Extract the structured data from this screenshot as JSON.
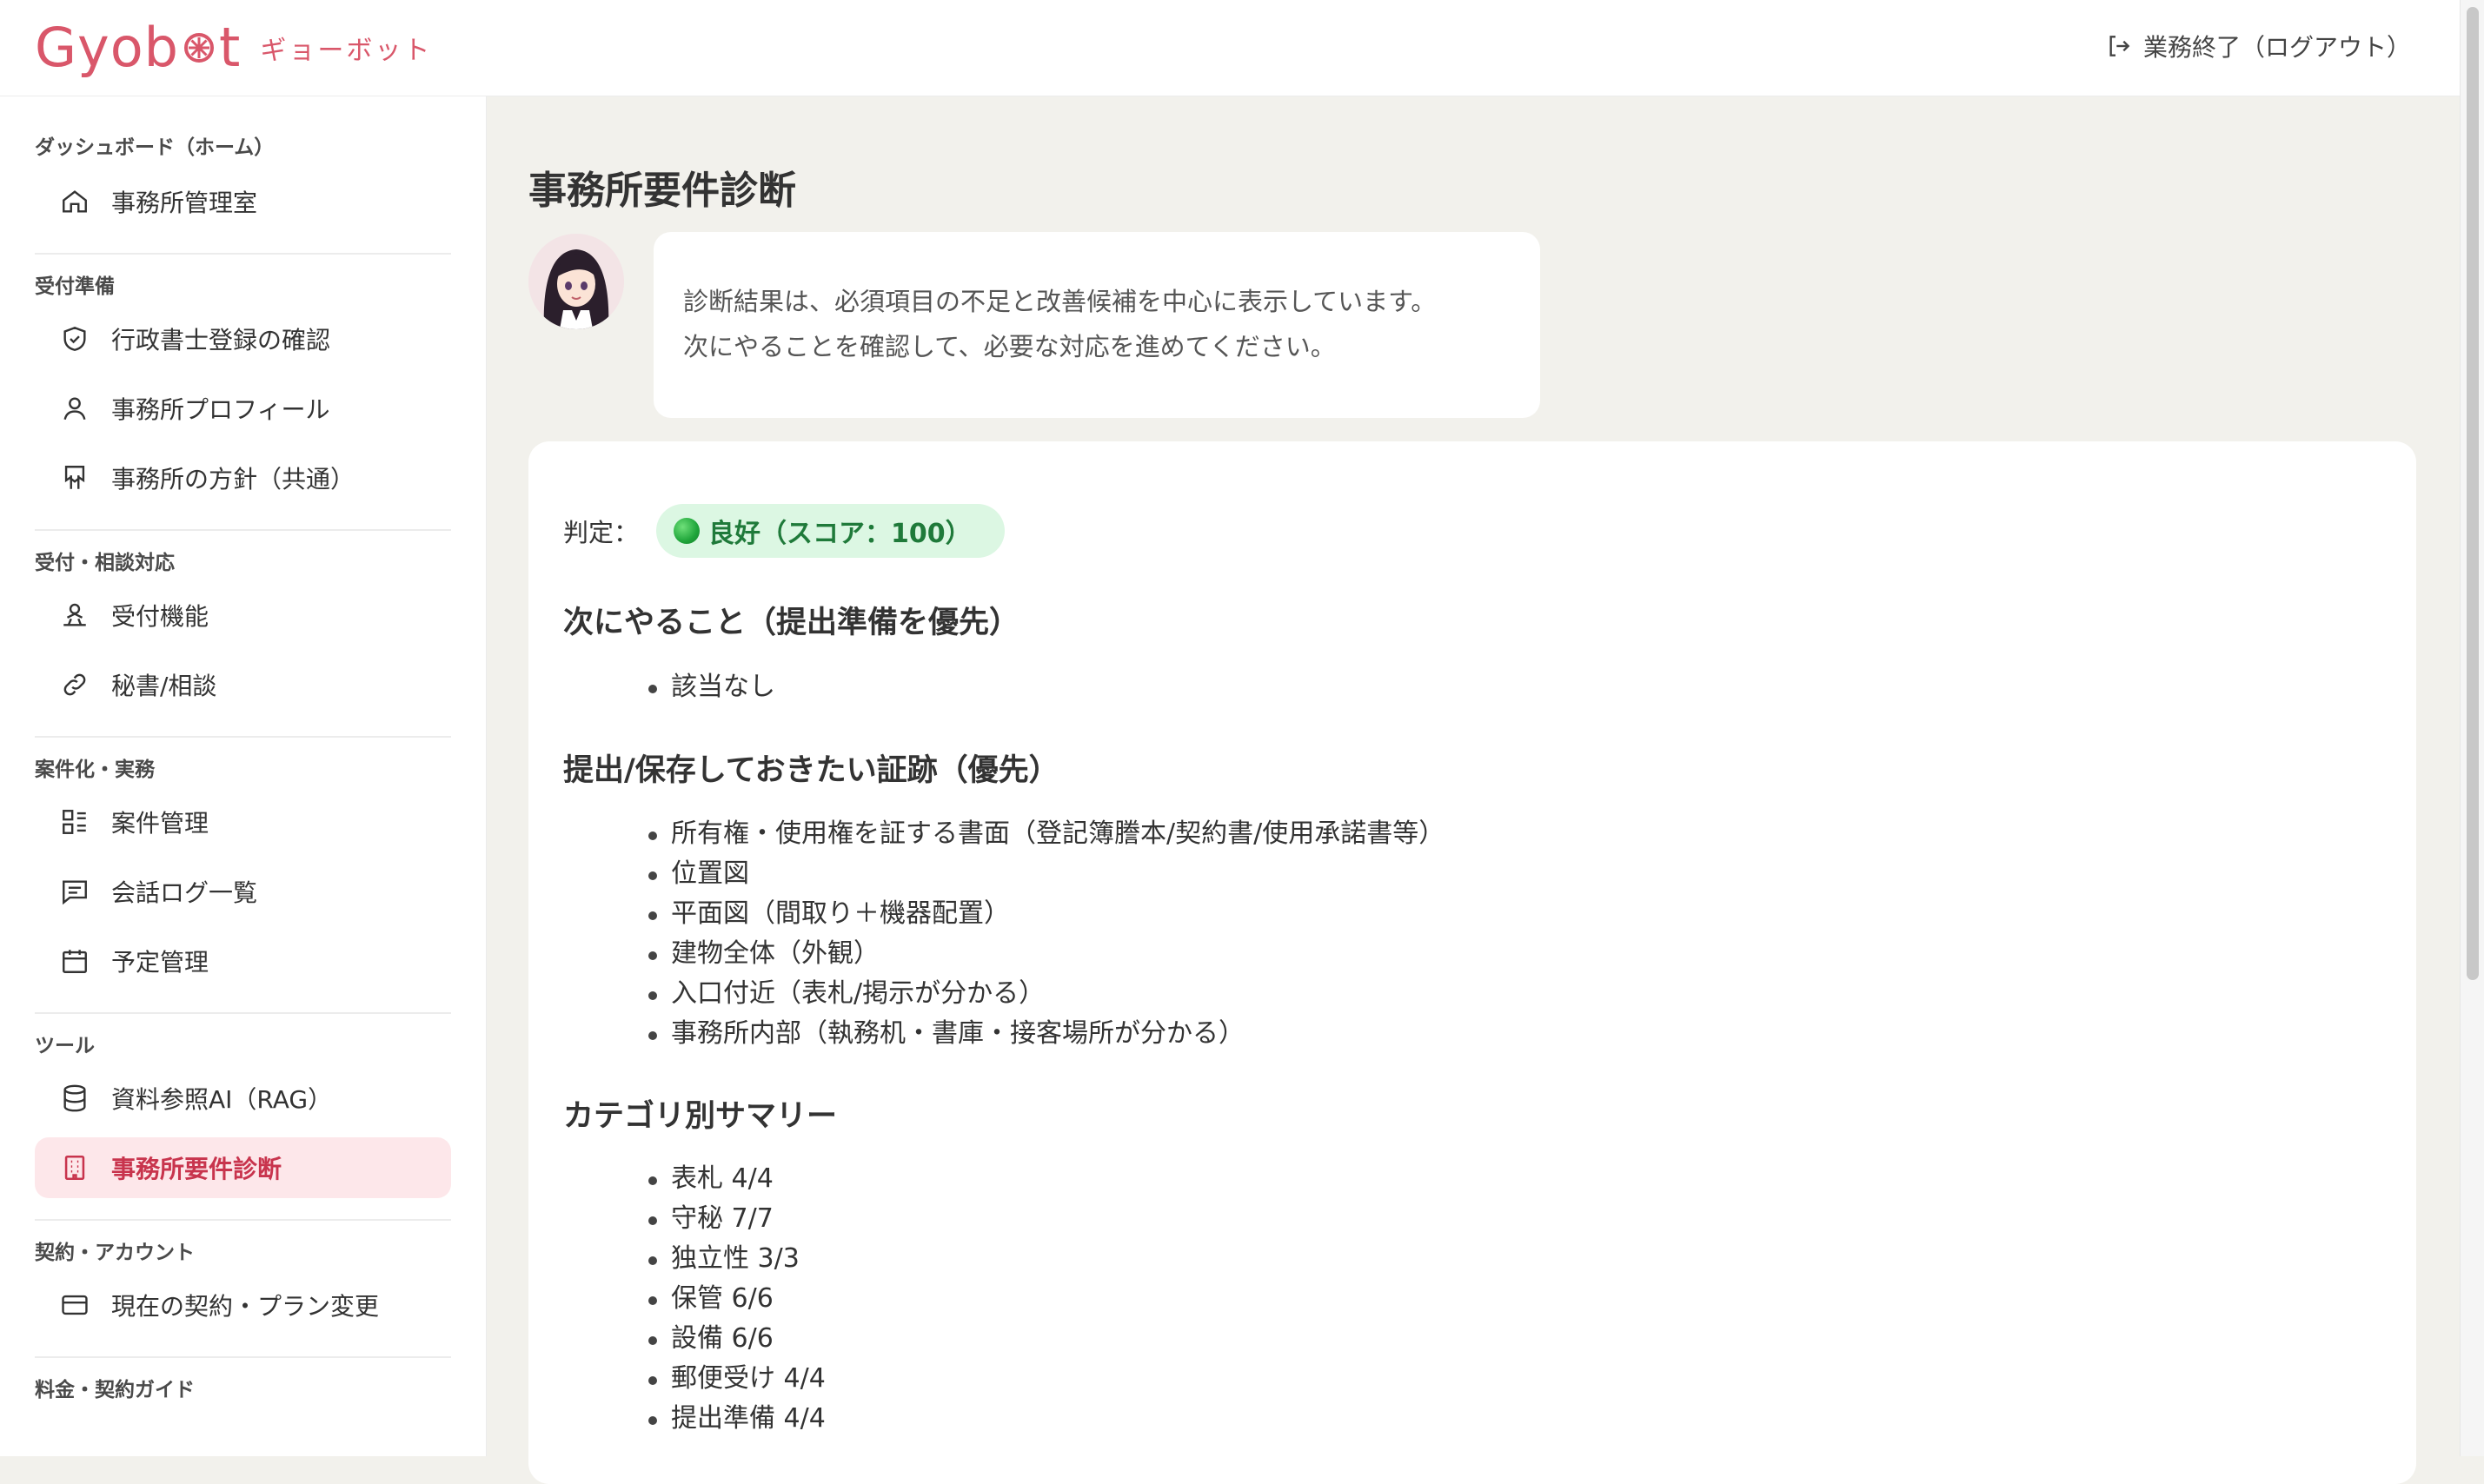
{
  "header": {
    "logo_text": "Gyobot",
    "logo_sub": "ギョーボット",
    "logout_label": "業務終了（ログアウト）",
    "brand_color": "#d9576a"
  },
  "sidebar": {
    "sections": [
      {
        "title": "ダッシュボード（ホーム）",
        "items": [
          {
            "label": "事務所管理室",
            "icon": "home-icon"
          }
        ]
      },
      {
        "title": "受付準備",
        "items": [
          {
            "label": "行政書士登録の確認",
            "icon": "shield-check-icon"
          },
          {
            "label": "事務所プロフィール",
            "icon": "user-icon"
          },
          {
            "label": "事務所の方針（共通）",
            "icon": "signpost-icon"
          }
        ]
      },
      {
        "title": "受付・相談対応",
        "items": [
          {
            "label": "受付機能",
            "icon": "reception-icon"
          },
          {
            "label": "秘書/相談",
            "icon": "link-icon"
          }
        ]
      },
      {
        "title": "案件化・実務",
        "items": [
          {
            "label": "案件管理",
            "icon": "list-grid-icon"
          },
          {
            "label": "会話ログ一覧",
            "icon": "chat-log-icon"
          },
          {
            "label": "予定管理",
            "icon": "calendar-icon"
          }
        ]
      },
      {
        "title": "ツール",
        "items": [
          {
            "label": "資料参照AI（RAG）",
            "icon": "database-icon"
          },
          {
            "label": "事務所要件診断",
            "icon": "building-icon",
            "active": true
          }
        ]
      },
      {
        "title": "契約・アカウント",
        "items": [
          {
            "label": "現在の契約・プラン変更",
            "icon": "credit-card-icon"
          }
        ]
      },
      {
        "title": "料金・契約ガイド",
        "items": []
      }
    ],
    "active_color": "#c8344d"
  },
  "main": {
    "title": "事務所要件診断",
    "bubble_lines": [
      "診断結果は、必須項目の不足と改善候補を中心に表示しています。",
      "次にやることを確認して、必要な対応を進めてください。"
    ],
    "verdict_label": "判定：",
    "verdict_badge": "良好（スコア：100）",
    "verdict_color": "#1f7a3a",
    "next_title": "次にやること（提出準備を優先）",
    "next_items": [
      "該当なし"
    ],
    "evidence_title": "提出/保存しておきたい証跡（優先）",
    "evidence_items": [
      "所有権・使用権を証する書面（登記簿謄本/契約書/使用承諾書等）",
      "位置図",
      "平面図（間取り＋機器配置）",
      "建物全体（外観）",
      "入口付近（表札/掲示が分かる）",
      "事務所内部（執務机・書庫・接客場所が分かる）"
    ],
    "summary_title": "カテゴリ別サマリー",
    "summary_items": [
      "表札 4/4",
      "守秘 7/7",
      "独立性 3/3",
      "保管 6/6",
      "設備 6/6",
      "郵便受け 4/4",
      "提出準備 4/4"
    ]
  }
}
